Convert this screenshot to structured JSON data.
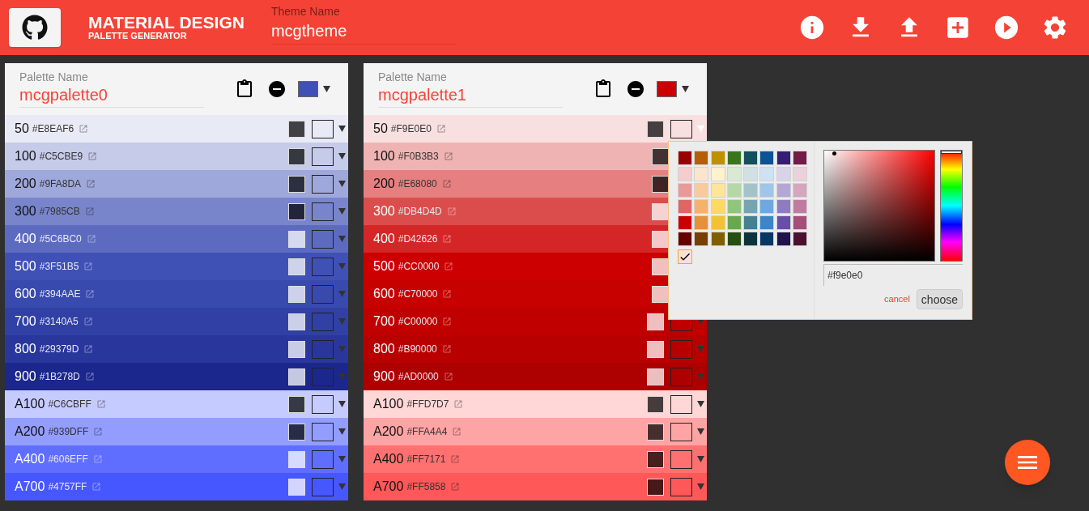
{
  "header": {
    "title": "MATERIAL DESIGN",
    "subtitle": "PALETTE GENERATOR",
    "theme_label": "Theme Name",
    "theme_value": "mcgtheme",
    "actions": [
      {
        "kind": "info"
      },
      {
        "kind": "download"
      },
      {
        "kind": "upload"
      },
      {
        "kind": "add"
      },
      {
        "kind": "play"
      },
      {
        "kind": "settings"
      }
    ]
  },
  "palettes": [
    {
      "label": "Palette Name",
      "name": "mcgpalette0",
      "color": "#3f51b5",
      "rows": [
        {
          "shade": "50",
          "hex": "#E8EAF6",
          "text_dark": true,
          "open": false
        },
        {
          "shade": "100",
          "hex": "#C5CBE9",
          "text_dark": true,
          "open": false
        },
        {
          "shade": "200",
          "hex": "#9FA8DA",
          "text_dark": true,
          "open": false
        },
        {
          "shade": "300",
          "hex": "#7985CB",
          "text_dark": true,
          "open": false
        },
        {
          "shade": "400",
          "hex": "#5C6BC0",
          "text_dark": false,
          "open": false
        },
        {
          "shade": "500",
          "hex": "#3F51B5",
          "text_dark": false,
          "open": false
        },
        {
          "shade": "600",
          "hex": "#394AAE",
          "text_dark": false,
          "open": false
        },
        {
          "shade": "700",
          "hex": "#3140A5",
          "text_dark": false,
          "open": false
        },
        {
          "shade": "800",
          "hex": "#29379D",
          "text_dark": false,
          "open": false
        },
        {
          "shade": "900",
          "hex": "#1B278D",
          "text_dark": false,
          "open": false
        },
        {
          "shade": "A100",
          "hex": "#C6CBFF",
          "text_dark": true,
          "open": false
        },
        {
          "shade": "A200",
          "hex": "#939DFF",
          "text_dark": true,
          "open": false
        },
        {
          "shade": "A400",
          "hex": "#606EFF",
          "text_dark": false,
          "open": false
        },
        {
          "shade": "A700",
          "hex": "#4757FF",
          "text_dark": false,
          "open": false
        }
      ]
    },
    {
      "label": "Palette Name",
      "name": "mcgpalette1",
      "color": "#cc0000",
      "rows": [
        {
          "shade": "50",
          "hex": "#F9E0E0",
          "text_dark": true,
          "open": true
        },
        {
          "shade": "100",
          "hex": "#F0B3B3",
          "text_dark": true,
          "open": false
        },
        {
          "shade": "200",
          "hex": "#E68080",
          "text_dark": true,
          "open": false
        },
        {
          "shade": "300",
          "hex": "#DB4D4D",
          "text_dark": false,
          "open": false
        },
        {
          "shade": "400",
          "hex": "#D42626",
          "text_dark": false,
          "open": false
        },
        {
          "shade": "500",
          "hex": "#CC0000",
          "text_dark": false,
          "open": false
        },
        {
          "shade": "600",
          "hex": "#C70000",
          "text_dark": false,
          "open": false
        },
        {
          "shade": "700",
          "hex": "#C00000",
          "text_dark": false,
          "open": false
        },
        {
          "shade": "800",
          "hex": "#B90000",
          "text_dark": false,
          "open": false
        },
        {
          "shade": "900",
          "hex": "#AD0000",
          "text_dark": false,
          "open": false
        },
        {
          "shade": "A100",
          "hex": "#FFD7D7",
          "text_dark": true,
          "open": false
        },
        {
          "shade": "A200",
          "hex": "#FFA4A4",
          "text_dark": true,
          "open": false
        },
        {
          "shade": "A400",
          "hex": "#FF7171",
          "text_dark": true,
          "open": false
        },
        {
          "shade": "A700",
          "hex": "#FF5858",
          "text_dark": true,
          "open": false
        }
      ]
    }
  ],
  "picker": {
    "swatches": [
      {
        "color": "#990000"
      },
      {
        "color": "#b45f06"
      },
      {
        "color": "#bf9000"
      },
      {
        "color": "#38761d"
      },
      {
        "color": "#134f5c"
      },
      {
        "color": "#0b5394"
      },
      {
        "color": "#351c75"
      },
      {
        "color": "#741b47"
      },
      {
        "color": "#f4cccc"
      },
      {
        "color": "#fce5cd"
      },
      {
        "color": "#fff2cc"
      },
      {
        "color": "#d9ead3"
      },
      {
        "color": "#d0e0e3"
      },
      {
        "color": "#cfe2f3"
      },
      {
        "color": "#d9d2e9"
      },
      {
        "color": "#ead1dc"
      },
      {
        "color": "#ea9999"
      },
      {
        "color": "#f9cb9c"
      },
      {
        "color": "#ffe599"
      },
      {
        "color": "#b6d7a8"
      },
      {
        "color": "#a2c4c9"
      },
      {
        "color": "#9fc5e8"
      },
      {
        "color": "#b4a7d6"
      },
      {
        "color": "#d5a6bd"
      },
      {
        "color": "#e06666"
      },
      {
        "color": "#f6b26b"
      },
      {
        "color": "#ffd966"
      },
      {
        "color": "#93c47d"
      },
      {
        "color": "#76a5af"
      },
      {
        "color": "#6fa8dc"
      },
      {
        "color": "#8e7cc3"
      },
      {
        "color": "#c27ba0"
      },
      {
        "color": "#cc0000"
      },
      {
        "color": "#e69138"
      },
      {
        "color": "#f1c232"
      },
      {
        "color": "#6aa84f"
      },
      {
        "color": "#45818e"
      },
      {
        "color": "#3d85c6"
      },
      {
        "color": "#674ea7"
      },
      {
        "color": "#a64d79"
      },
      {
        "color": "#660000"
      },
      {
        "color": "#783f04"
      },
      {
        "color": "#7f6000"
      },
      {
        "color": "#274e13"
      },
      {
        "color": "#0c343d"
      },
      {
        "color": "#073763"
      },
      {
        "color": "#20124d"
      },
      {
        "color": "#4c1130"
      }
    ],
    "current": {
      "color": "#f9e0e0",
      "selected": true
    },
    "hue": {
      "level": 0
    },
    "value": "#f9e0e0",
    "cancel": "cancel",
    "choose": "choose"
  }
}
